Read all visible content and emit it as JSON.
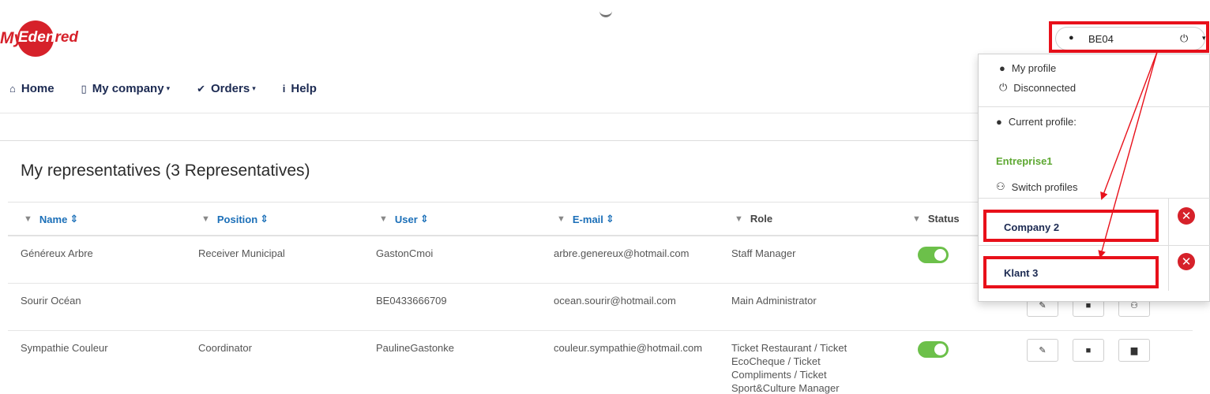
{
  "logo": {
    "my": "My",
    "word_white": "Eden",
    "word_red": "red"
  },
  "nav": [
    {
      "icon": "⌂",
      "label": "Home",
      "caret": ""
    },
    {
      "icon": "▯",
      "label": "My company",
      "caret": "▾"
    },
    {
      "icon": "✔",
      "label": "Orders",
      "caret": "▾"
    },
    {
      "icon": "i",
      "label": "Help",
      "caret": ""
    }
  ],
  "page_title": "My representatives (3 Representatives)",
  "table": {
    "headers": [
      "Name",
      "Position",
      "User",
      "E-mail",
      "Role",
      "Status"
    ],
    "sort_glyph": "⇕",
    "rows": [
      {
        "name": "Généreux Arbre",
        "position": "Receiver Municipal",
        "user": "GastonCmoi",
        "email": "arbre.genereux@hotmail.com",
        "role": "Staff Manager",
        "active": true
      },
      {
        "name": "Sourir Océan",
        "position": "",
        "user": "BE0433666709",
        "email": "ocean.sourir@hotmail.com",
        "role": "Main Administrator",
        "active": false
      },
      {
        "name": "Sympathie Couleur",
        "position": "Coordinator",
        "user": "PaulineGastonke",
        "email": "couleur.sympathie@hotmail.com",
        "role": "Ticket Restaurant / Ticket EcoCheque / Ticket Compliments / Ticket Sport&Culture Manager",
        "active": true
      }
    ]
  },
  "user_menu": {
    "code": "BE04",
    "items": {
      "my_profile": "My profile",
      "disconnected": "Disconnected",
      "current_profile": "Current profile:",
      "current_company": "Entreprise1",
      "switch_profiles": "Switch profiles"
    },
    "profiles": [
      "Company 2",
      "Klant 3"
    ],
    "remove_glyph": "✕"
  },
  "colors": {
    "brand_red": "#d6212a",
    "nav_text": "#1c2a52",
    "link_blue": "#1b6fb8",
    "toggle_green": "#6cc04a",
    "current_company_green": "#5ea832",
    "highlight_red": "#e8101a"
  }
}
